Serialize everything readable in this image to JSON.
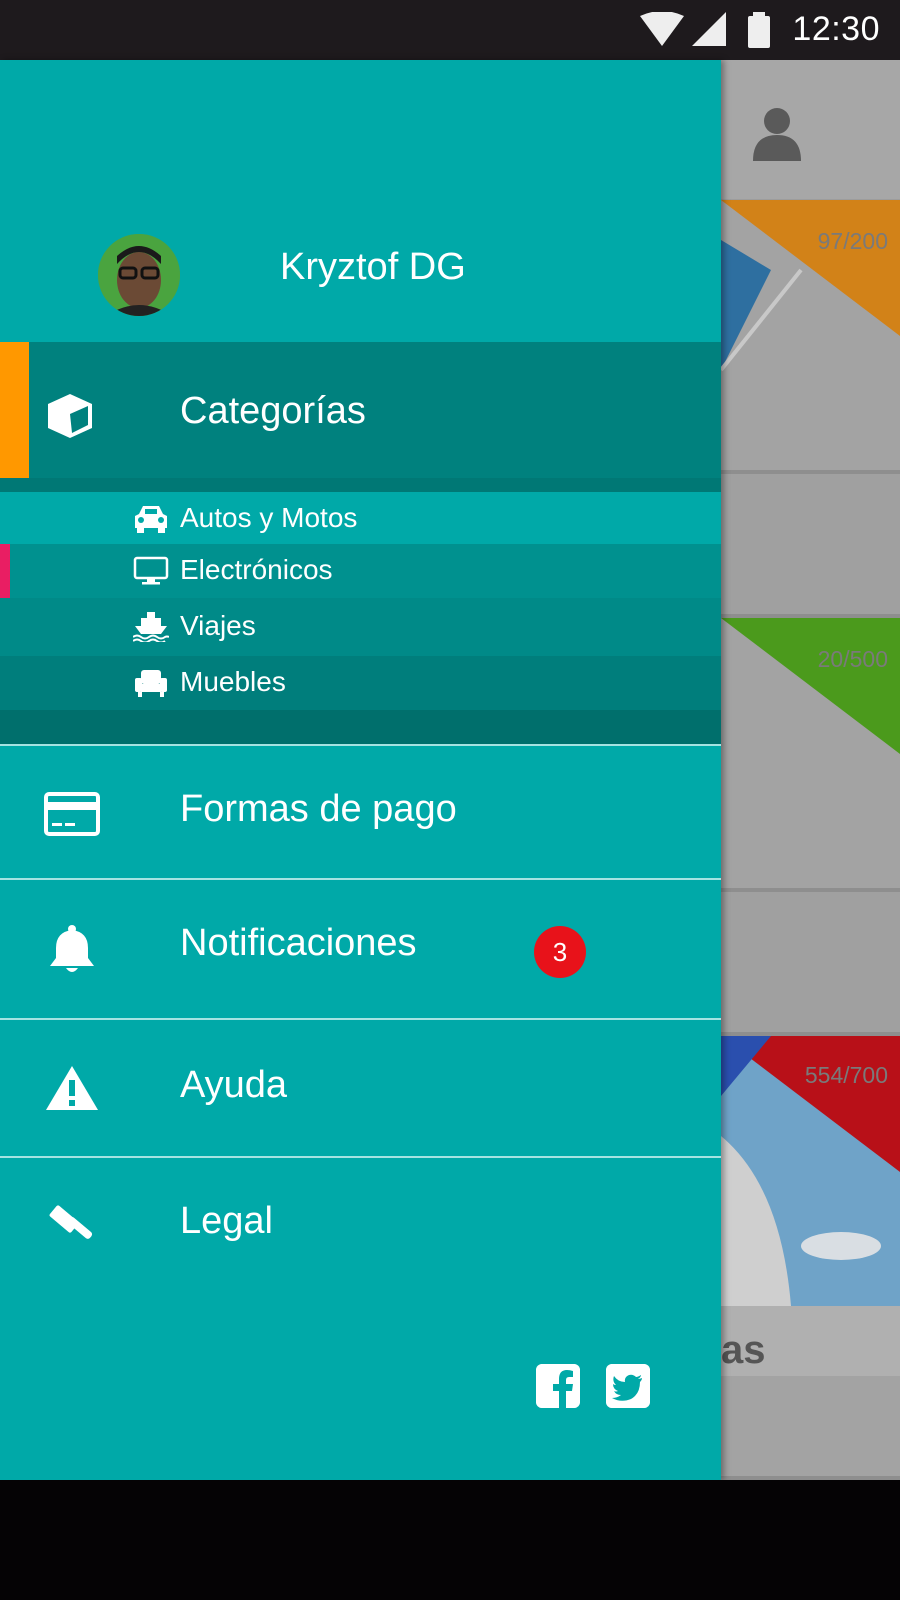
{
  "status_bar": {
    "time": "12:30",
    "icons": [
      "wifi-icon",
      "signal-icon",
      "battery-icon"
    ]
  },
  "background_app": {
    "cards": [
      {
        "counter": "97/200",
        "accent": "#e08a10"
      },
      {
        "counter": "20/500",
        "accent": "#4a9a1c"
      },
      {
        "counter": "554/700",
        "accent": "#c0101a"
      }
    ],
    "partial_text": "as"
  },
  "drawer": {
    "profile": {
      "name": "Kryztof DG"
    },
    "categories": {
      "label": "Categorías",
      "icon": "cube-icon",
      "accent": "#ff9800",
      "sub_items": [
        {
          "label": "Autos y Motos",
          "icon": "car-icon"
        },
        {
          "label": "Electrónicos",
          "icon": "monitor-icon",
          "accent": "#e91e63"
        },
        {
          "label": "Viajes",
          "icon": "ship-icon"
        },
        {
          "label": "Muebles",
          "icon": "armchair-icon"
        }
      ]
    },
    "menu": [
      {
        "label": "Formas de pago",
        "icon": "credit-card-icon"
      },
      {
        "label": "Notificaciones",
        "icon": "bell-icon",
        "badge": "3"
      },
      {
        "label": "Ayuda",
        "icon": "warning-icon"
      },
      {
        "label": "Legal",
        "icon": "gavel-icon"
      }
    ],
    "social": [
      "facebook-icon",
      "twitter-icon"
    ]
  },
  "colors": {
    "drawer": "#00a9a8",
    "selected": "#00817e",
    "badge": "#e8121a"
  }
}
